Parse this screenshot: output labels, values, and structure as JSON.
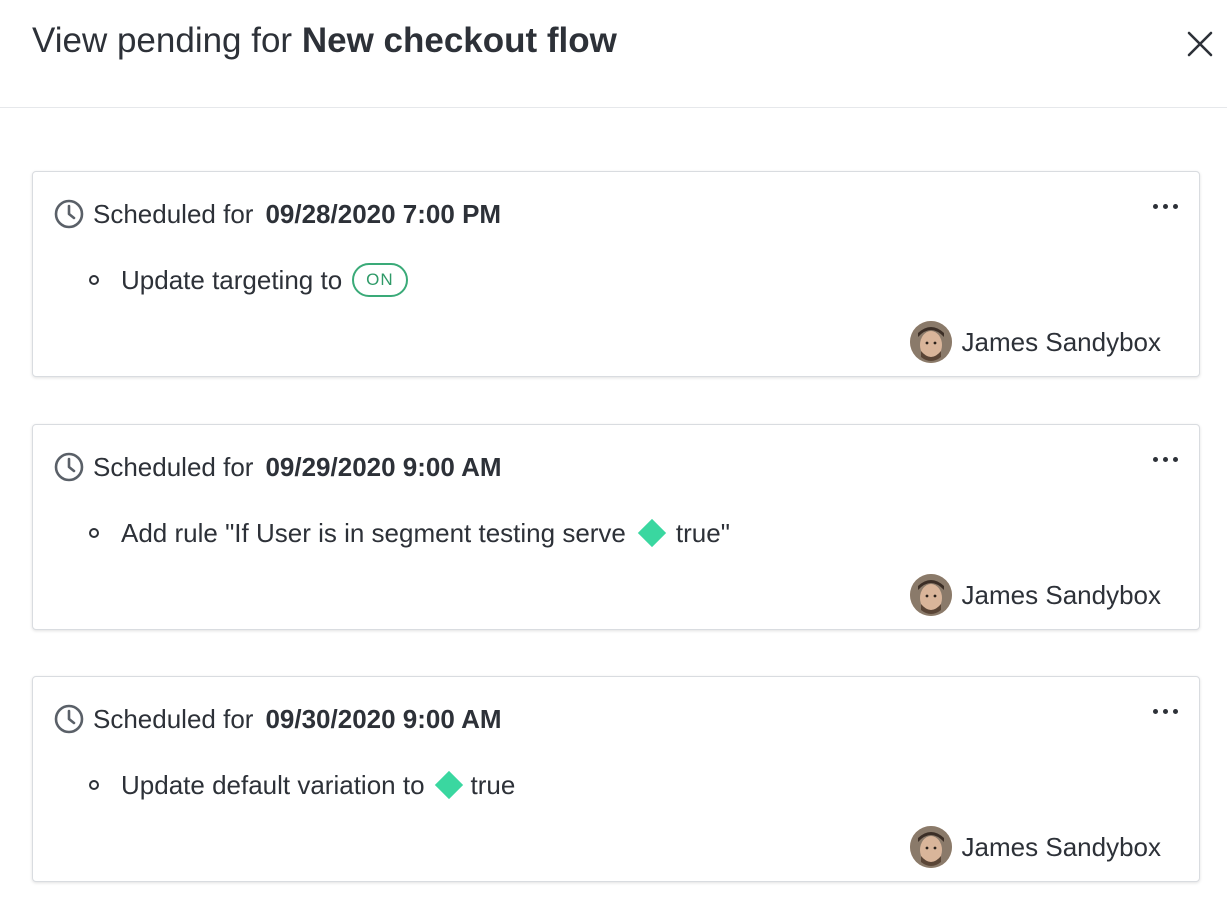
{
  "header": {
    "title_prefix": "View pending for",
    "flag_name": "New checkout flow",
    "close_icon": "close-icon"
  },
  "colors": {
    "text": "#2d3138",
    "variation_diamond": "#3ad7a0",
    "on_badge": "#2f9a68",
    "border": "#d9dce0"
  },
  "changes": [
    {
      "scheduled_label": "Scheduled for",
      "date": "09/28/2020 7:00 PM",
      "instruction": {
        "text": "Update targeting to",
        "badge": "ON"
      },
      "author": "James Sandybox"
    },
    {
      "scheduled_label": "Scheduled for",
      "date": "09/29/2020 9:00 AM",
      "instruction": {
        "text": "Add rule \"If User is in segment testing serve",
        "variation": "true\""
      },
      "author": "James Sandybox"
    },
    {
      "scheduled_label": "Scheduled for",
      "date": "09/30/2020 9:00 AM",
      "instruction": {
        "text": "Update default variation to",
        "variation": "true"
      },
      "author": "James Sandybox"
    }
  ]
}
